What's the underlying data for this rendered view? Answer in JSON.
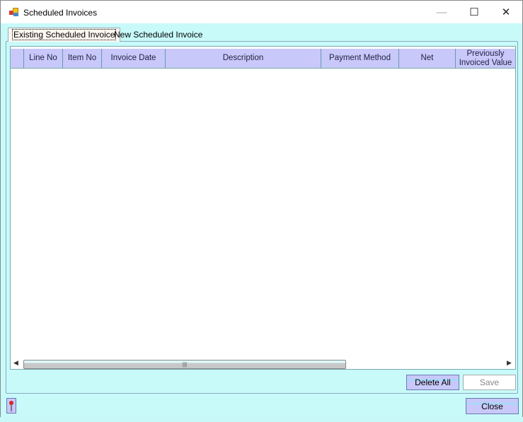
{
  "window": {
    "title": "Scheduled Invoices",
    "minimize": "—",
    "maximize": "☐",
    "close": "✕"
  },
  "tabs": [
    {
      "label": "Existing Scheduled Invoice",
      "active": true
    },
    {
      "label": "New Scheduled Invoice",
      "active": false
    }
  ],
  "grid": {
    "columns": [
      "Line No",
      "Item No",
      "Invoice Date",
      "Description",
      "Payment Method",
      "Net",
      "Previously Invoiced Value"
    ],
    "rows": []
  },
  "scroll": {
    "left": "◀",
    "right": "▶",
    "grip": "|||"
  },
  "buttons": {
    "delete_all": "Delete All",
    "save": "Save",
    "close": "Close"
  },
  "colors": {
    "background": "#c8fafa",
    "header": "#c8c8fa"
  }
}
